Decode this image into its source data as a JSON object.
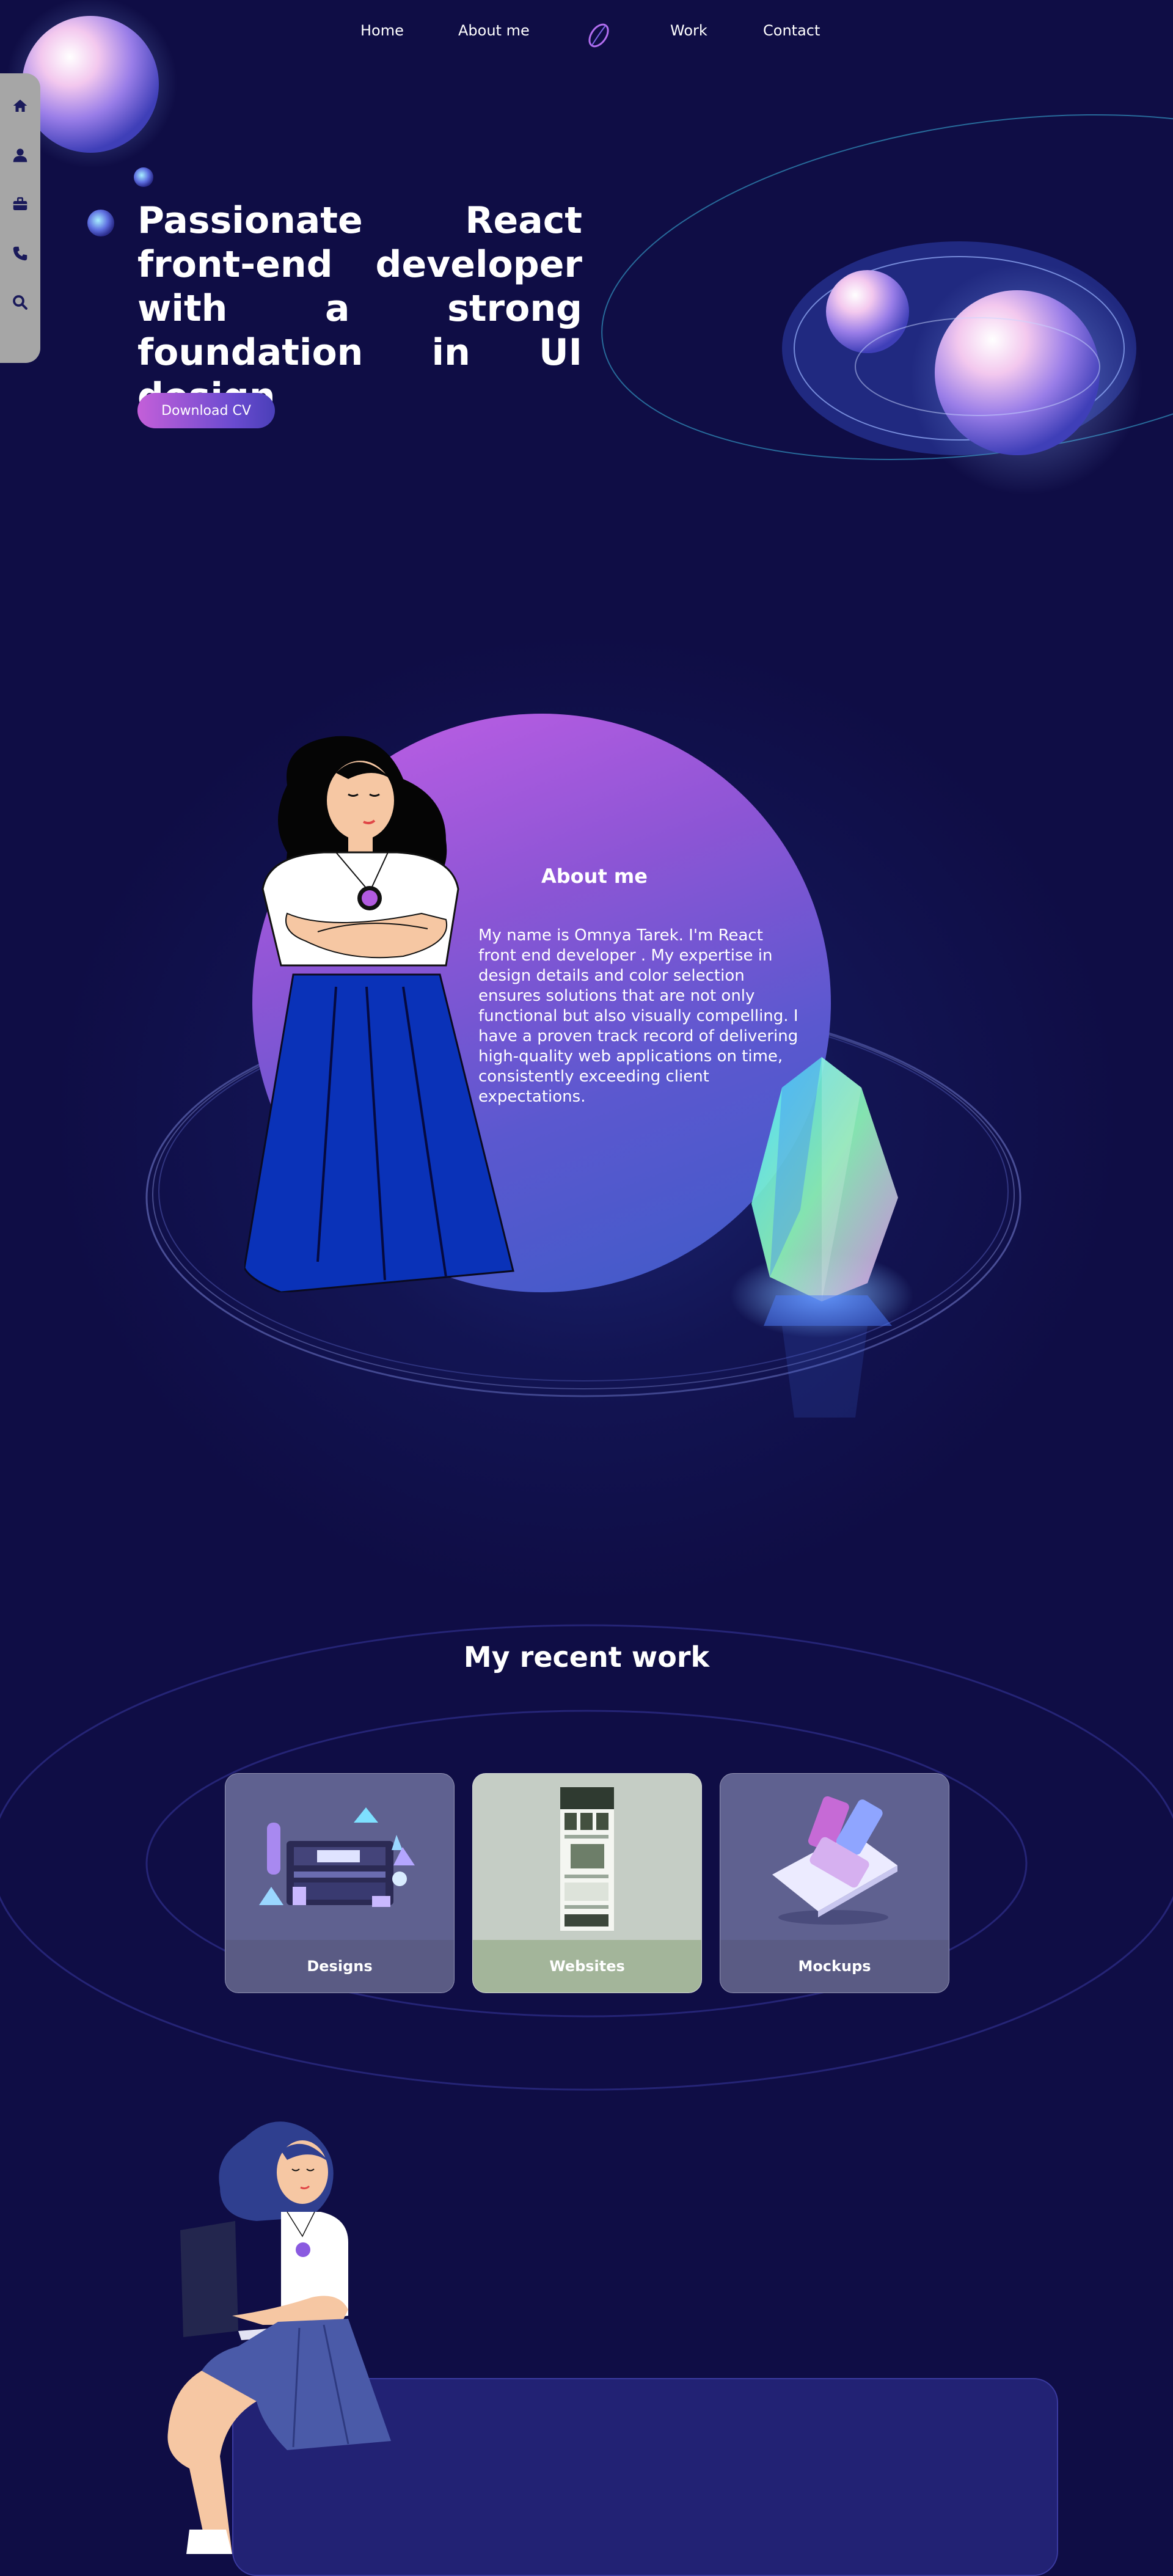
{
  "nav": {
    "links": [
      "Home",
      "About me",
      "Work",
      "Contact"
    ],
    "logo_icon": "script-o-logo-icon"
  },
  "sidebar": {
    "icons": [
      "home-icon",
      "user-icon",
      "briefcase-icon",
      "phone-icon",
      "search-icon"
    ]
  },
  "hero": {
    "title": "Passionate React front-end developer with a strong foundation in UI design",
    "button_label": "Download CV"
  },
  "about": {
    "title": "About me",
    "text": "My name is Omnya Tarek. I'm React front end developer . My expertise in design details and color selection ensures solutions that are not only functional but also visually compelling. I have a proven track record of delivering high-quality web applications on time, consistently exceeding client expectations."
  },
  "work": {
    "title": "My recent work",
    "cards": [
      {
        "label": "Designs"
      },
      {
        "label": "Websites"
      },
      {
        "label": "Mockups"
      }
    ]
  },
  "colors": {
    "background": "#0f0d45",
    "accent_pink": "#c45fd9",
    "accent_blue": "#3d5bc8",
    "card_footer_green": "#a3b59a"
  }
}
